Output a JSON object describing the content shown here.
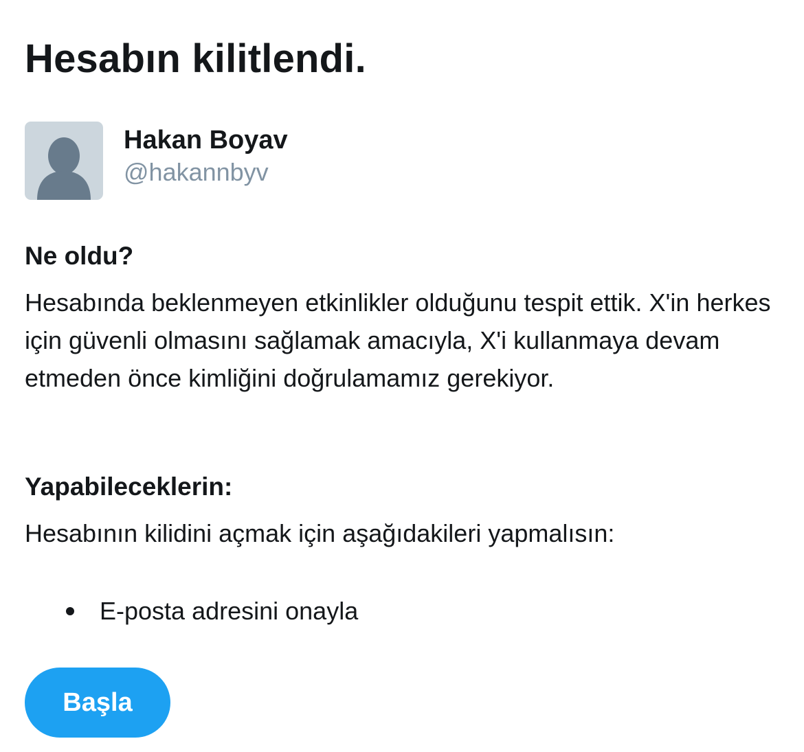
{
  "page": {
    "title": "Hesabın kilitlendi."
  },
  "profile": {
    "avatar_icon": "default-user-silhouette-icon",
    "display_name": "Hakan Boyav",
    "handle": "@hakannbyv"
  },
  "what_happened": {
    "heading": "Ne oldu?",
    "body": "Hesabında beklenmeyen etkinlikler olduğunu tespit ettik. X'in herkes için güvenli olmasını sağlamak amacıyla, X'i kullanmaya devam etmeden önce kimliğini doğrulamamız gerekiyor."
  },
  "actions": {
    "heading": "Yapabileceklerin:",
    "body": "Hesabının kilidini açmak için aşağıdakileri yapmalısın:",
    "steps": [
      {
        "label": "E-posta adresini onayla"
      }
    ]
  },
  "cta": {
    "label": "Başla"
  },
  "colors": {
    "accent": "#1da1f2",
    "text": "#14171a",
    "secondary_text": "#8193a3",
    "avatar_bg": "#ccd6dd",
    "avatar_figure": "#687b8c"
  }
}
